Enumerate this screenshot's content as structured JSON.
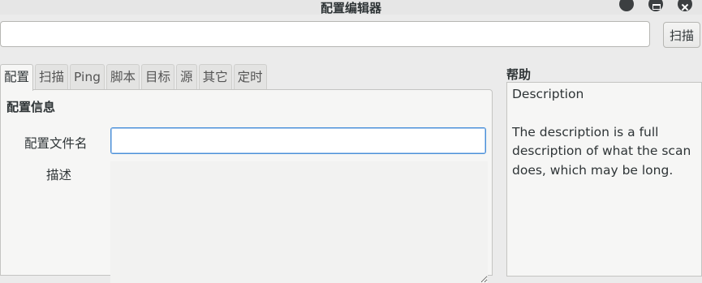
{
  "window": {
    "title": "配置编辑器"
  },
  "toolbar": {
    "target_value": "",
    "scan_label": "扫描"
  },
  "tabs": [
    {
      "label": "配置",
      "active": true
    },
    {
      "label": "扫描",
      "active": false
    },
    {
      "label": "Ping",
      "active": false
    },
    {
      "label": "脚本",
      "active": false
    },
    {
      "label": "目标",
      "active": false
    },
    {
      "label": "源",
      "active": false
    },
    {
      "label": "其它",
      "active": false
    },
    {
      "label": "定时",
      "active": false
    }
  ],
  "profile": {
    "section_title": "配置信息",
    "filename_label": "配置文件名",
    "filename_value": "",
    "description_label": "描述",
    "description_value": ""
  },
  "help": {
    "heading": "帮助",
    "title": "Description",
    "body": "The description is a full description of what the scan does, which may be long."
  }
}
